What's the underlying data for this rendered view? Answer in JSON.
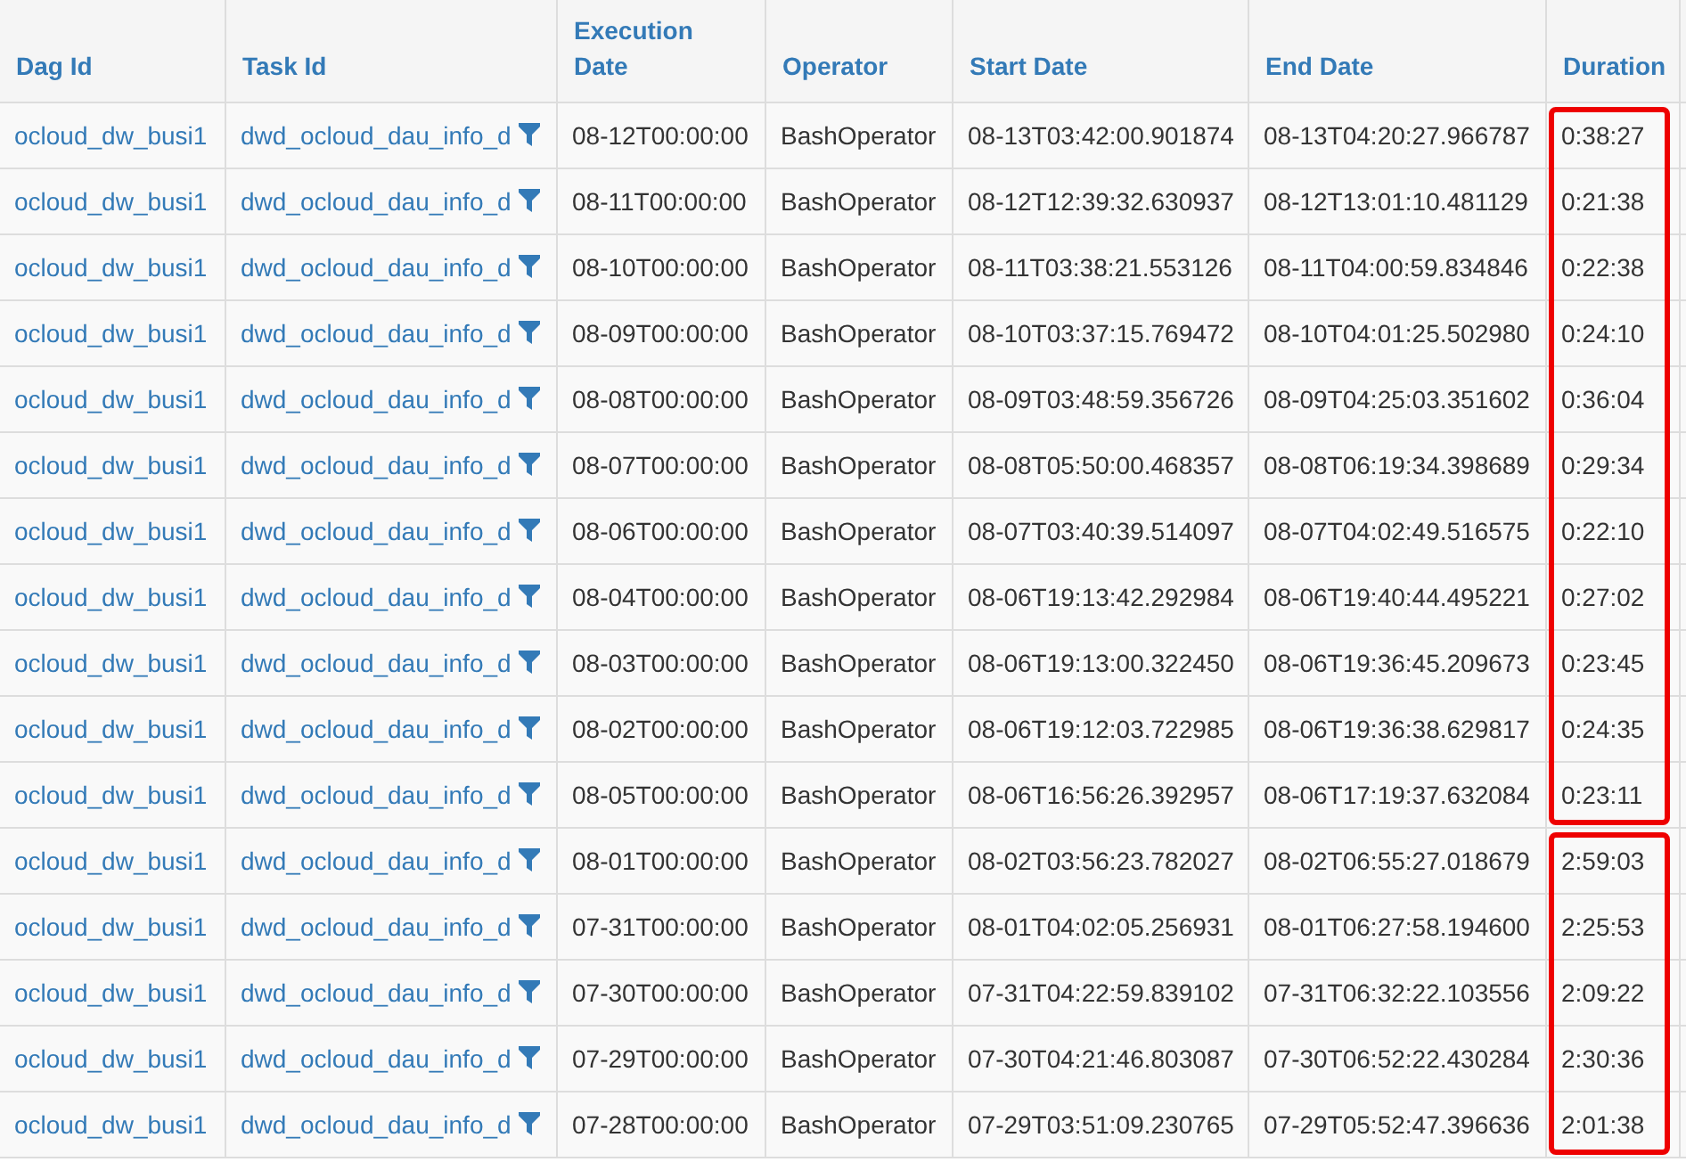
{
  "table": {
    "columns": [
      "Dag Id",
      "Task Id",
      "Execution Date",
      "Operator",
      "Start Date",
      "End Date",
      "Duration"
    ],
    "groups": [
      {
        "highlighted": true,
        "rows": [
          {
            "dag_id": "ocloud_dw_busi1",
            "task_id": "dwd_ocloud_dau_info_d",
            "execution_date": "08-12T00:00:00",
            "operator": "BashOperator",
            "start_date": "08-13T03:42:00.901874",
            "end_date": "08-13T04:20:27.966787",
            "duration": "0:38:27"
          },
          {
            "dag_id": "ocloud_dw_busi1",
            "task_id": "dwd_ocloud_dau_info_d",
            "execution_date": "08-11T00:00:00",
            "operator": "BashOperator",
            "start_date": "08-12T12:39:32.630937",
            "end_date": "08-12T13:01:10.481129",
            "duration": "0:21:38"
          },
          {
            "dag_id": "ocloud_dw_busi1",
            "task_id": "dwd_ocloud_dau_info_d",
            "execution_date": "08-10T00:00:00",
            "operator": "BashOperator",
            "start_date": "08-11T03:38:21.553126",
            "end_date": "08-11T04:00:59.834846",
            "duration": "0:22:38"
          },
          {
            "dag_id": "ocloud_dw_busi1",
            "task_id": "dwd_ocloud_dau_info_d",
            "execution_date": "08-09T00:00:00",
            "operator": "BashOperator",
            "start_date": "08-10T03:37:15.769472",
            "end_date": "08-10T04:01:25.502980",
            "duration": "0:24:10"
          },
          {
            "dag_id": "ocloud_dw_busi1",
            "task_id": "dwd_ocloud_dau_info_d",
            "execution_date": "08-08T00:00:00",
            "operator": "BashOperator",
            "start_date": "08-09T03:48:59.356726",
            "end_date": "08-09T04:25:03.351602",
            "duration": "0:36:04"
          },
          {
            "dag_id": "ocloud_dw_busi1",
            "task_id": "dwd_ocloud_dau_info_d",
            "execution_date": "08-07T00:00:00",
            "operator": "BashOperator",
            "start_date": "08-08T05:50:00.468357",
            "end_date": "08-08T06:19:34.398689",
            "duration": "0:29:34"
          },
          {
            "dag_id": "ocloud_dw_busi1",
            "task_id": "dwd_ocloud_dau_info_d",
            "execution_date": "08-06T00:00:00",
            "operator": "BashOperator",
            "start_date": "08-07T03:40:39.514097",
            "end_date": "08-07T04:02:49.516575",
            "duration": "0:22:10"
          },
          {
            "dag_id": "ocloud_dw_busi1",
            "task_id": "dwd_ocloud_dau_info_d",
            "execution_date": "08-04T00:00:00",
            "operator": "BashOperator",
            "start_date": "08-06T19:13:42.292984",
            "end_date": "08-06T19:40:44.495221",
            "duration": "0:27:02"
          },
          {
            "dag_id": "ocloud_dw_busi1",
            "task_id": "dwd_ocloud_dau_info_d",
            "execution_date": "08-03T00:00:00",
            "operator": "BashOperator",
            "start_date": "08-06T19:13:00.322450",
            "end_date": "08-06T19:36:45.209673",
            "duration": "0:23:45"
          },
          {
            "dag_id": "ocloud_dw_busi1",
            "task_id": "dwd_ocloud_dau_info_d",
            "execution_date": "08-02T00:00:00",
            "operator": "BashOperator",
            "start_date": "08-06T19:12:03.722985",
            "end_date": "08-06T19:36:38.629817",
            "duration": "0:24:35"
          },
          {
            "dag_id": "ocloud_dw_busi1",
            "task_id": "dwd_ocloud_dau_info_d",
            "execution_date": "08-05T00:00:00",
            "operator": "BashOperator",
            "start_date": "08-06T16:56:26.392957",
            "end_date": "08-06T17:19:37.632084",
            "duration": "0:23:11"
          }
        ]
      },
      {
        "highlighted": true,
        "rows": [
          {
            "dag_id": "ocloud_dw_busi1",
            "task_id": "dwd_ocloud_dau_info_d",
            "execution_date": "08-01T00:00:00",
            "operator": "BashOperator",
            "start_date": "08-02T03:56:23.782027",
            "end_date": "08-02T06:55:27.018679",
            "duration": "2:59:03"
          },
          {
            "dag_id": "ocloud_dw_busi1",
            "task_id": "dwd_ocloud_dau_info_d",
            "execution_date": "07-31T00:00:00",
            "operator": "BashOperator",
            "start_date": "08-01T04:02:05.256931",
            "end_date": "08-01T06:27:58.194600",
            "duration": "2:25:53"
          },
          {
            "dag_id": "ocloud_dw_busi1",
            "task_id": "dwd_ocloud_dau_info_d",
            "execution_date": "07-30T00:00:00",
            "operator": "BashOperator",
            "start_date": "07-31T04:22:59.839102",
            "end_date": "07-31T06:32:22.103556",
            "duration": "2:09:22"
          },
          {
            "dag_id": "ocloud_dw_busi1",
            "task_id": "dwd_ocloud_dau_info_d",
            "execution_date": "07-29T00:00:00",
            "operator": "BashOperator",
            "start_date": "07-30T04:21:46.803087",
            "end_date": "07-30T06:52:22.430284",
            "duration": "2:30:36"
          },
          {
            "dag_id": "ocloud_dw_busi1",
            "task_id": "dwd_ocloud_dau_info_d",
            "execution_date": "07-28T00:00:00",
            "operator": "BashOperator",
            "start_date": "07-29T03:51:09.230765",
            "end_date": "07-29T05:52:47.396636",
            "duration": "2:01:38"
          }
        ]
      }
    ]
  }
}
